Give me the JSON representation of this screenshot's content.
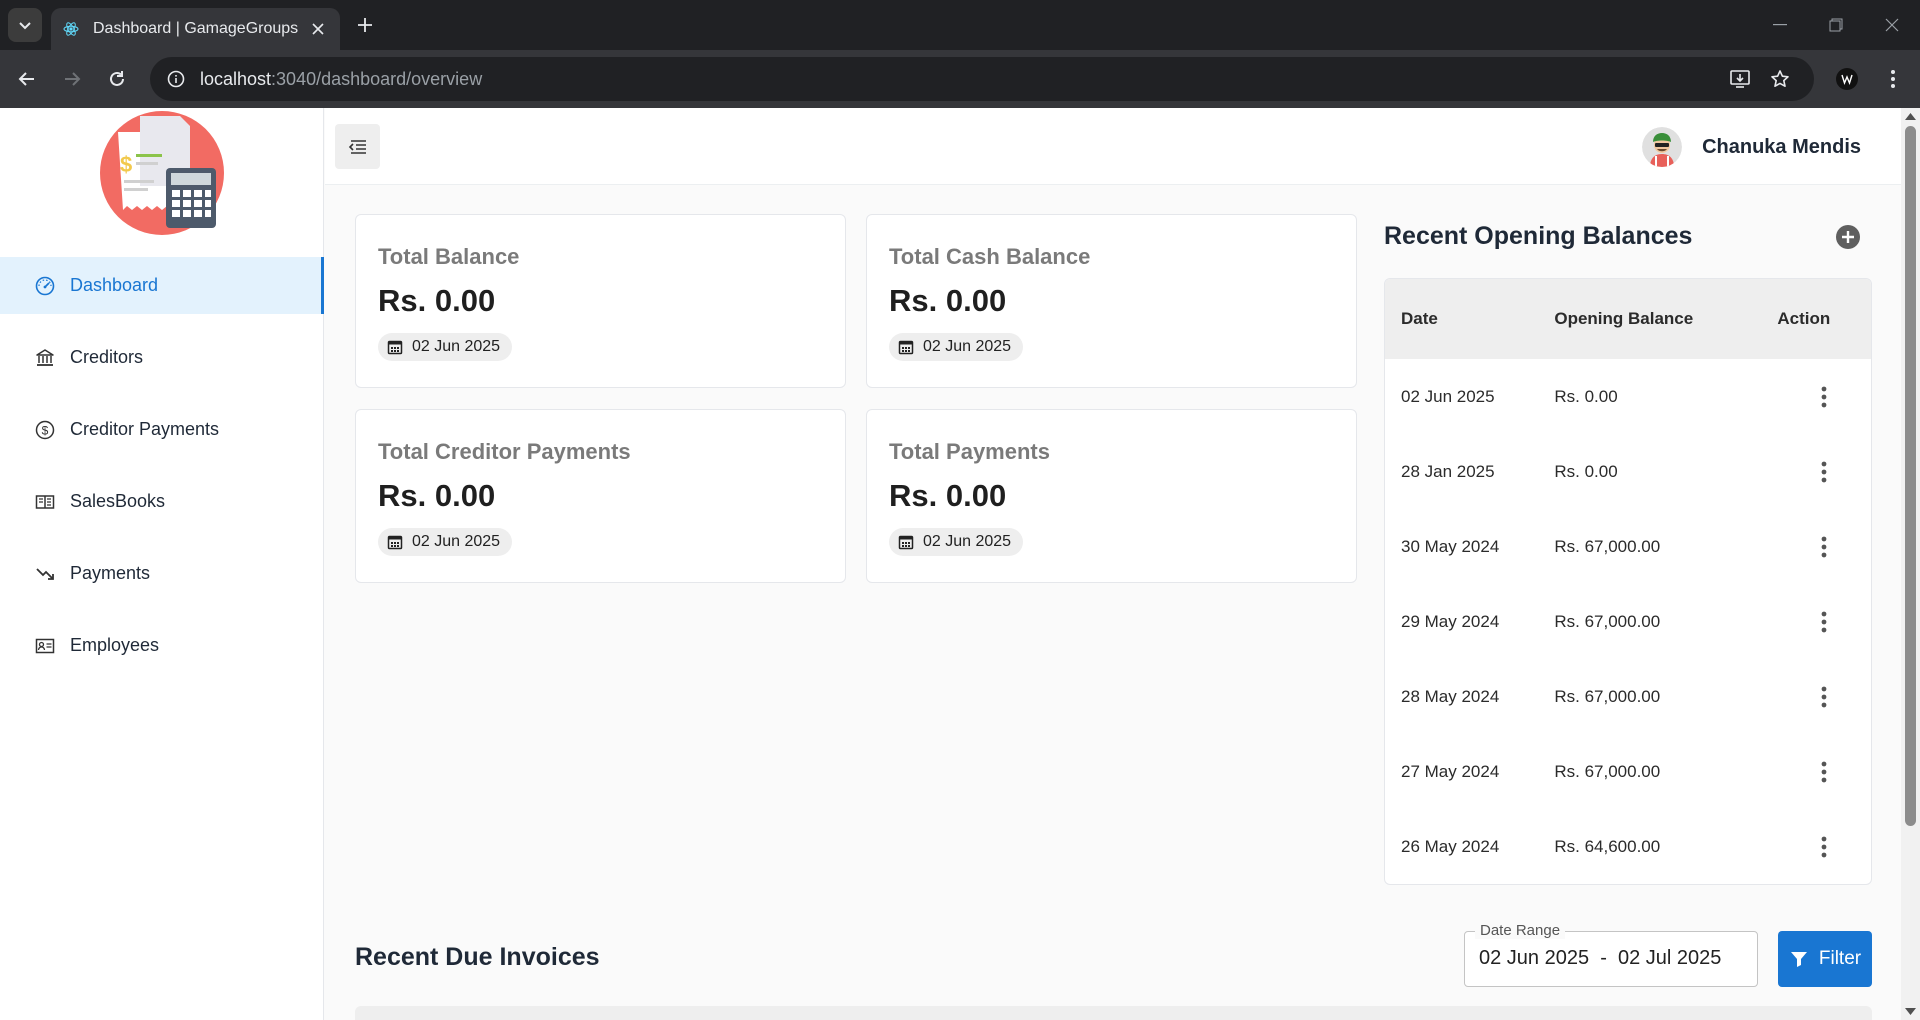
{
  "browser": {
    "tab_title": "Dashboard | GamageGroups",
    "url_host": "localhost",
    "url_path": ":3040/dashboard/overview"
  },
  "sidebar": {
    "items": [
      {
        "label": "Dashboard",
        "icon": "speedometer-icon",
        "active": true
      },
      {
        "label": "Creditors",
        "icon": "bank-icon"
      },
      {
        "label": "Creditor Payments",
        "icon": "dollar-circle-icon"
      },
      {
        "label": "SalesBooks",
        "icon": "book-open-icon"
      },
      {
        "label": "Payments",
        "icon": "trend-down-icon"
      },
      {
        "label": "Employees",
        "icon": "id-card-icon"
      }
    ]
  },
  "header": {
    "user_name": "Chanuka Mendis"
  },
  "cards": [
    {
      "title": "Total Balance",
      "value": "Rs. 0.00",
      "date": "02 Jun 2025"
    },
    {
      "title": "Total Cash Balance",
      "value": "Rs. 0.00",
      "date": "02 Jun 2025"
    },
    {
      "title": "Total Creditor Payments",
      "value": "Rs. 0.00",
      "date": "02 Jun 2025"
    },
    {
      "title": "Total Payments",
      "value": "Rs. 0.00",
      "date": "02 Jun 2025"
    }
  ],
  "opening_balances": {
    "title": "Recent Opening Balances",
    "columns": [
      "Date",
      "Opening Balance",
      "Action"
    ],
    "rows": [
      {
        "date": "02 Jun 2025",
        "balance": "Rs. 0.00"
      },
      {
        "date": "28 Jan 2025",
        "balance": "Rs. 0.00"
      },
      {
        "date": "30 May 2024",
        "balance": "Rs. 67,000.00"
      },
      {
        "date": "29 May 2024",
        "balance": "Rs. 67,000.00"
      },
      {
        "date": "28 May 2024",
        "balance": "Rs. 67,000.00"
      },
      {
        "date": "27 May 2024",
        "balance": "Rs. 67,000.00"
      },
      {
        "date": "26 May 2024",
        "balance": "Rs. 64,600.00"
      }
    ]
  },
  "due_invoices": {
    "title": "Recent Due Invoices",
    "date_range_label": "Date Range",
    "date_range_value": "02 Jun 2025  -  02 Jul 2025",
    "filter_label": "Filter"
  },
  "colors": {
    "accent": "#1976d2",
    "active_bg": "#e3f2fd",
    "logo_circle": "#f26b63"
  }
}
